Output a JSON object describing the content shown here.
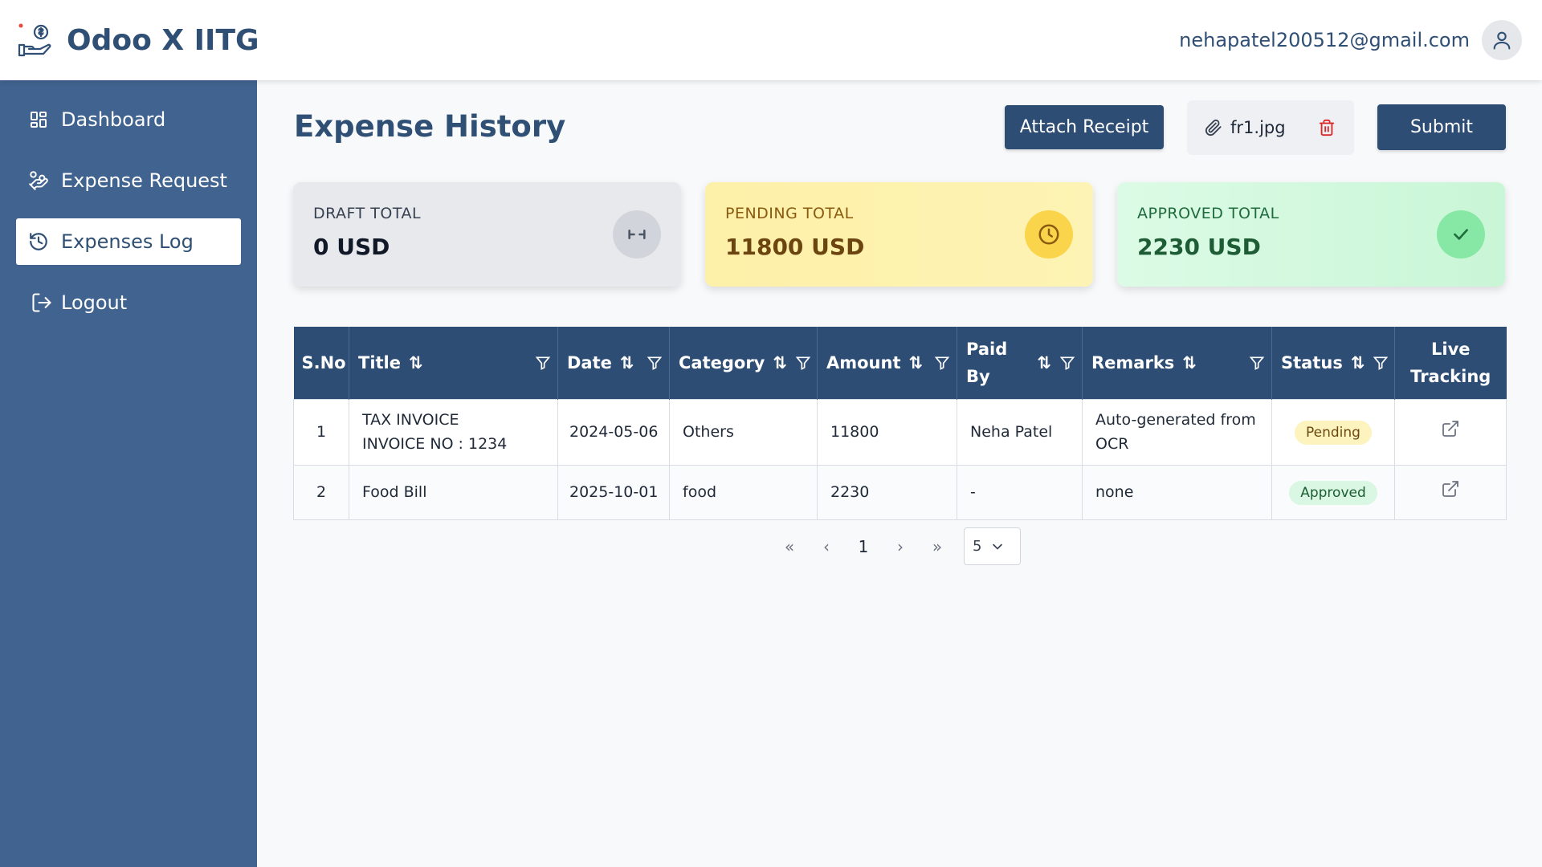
{
  "app": {
    "title": "Odoo X IITG",
    "user_email": "nehapatel200512@gmail.com"
  },
  "sidebar": {
    "items": [
      {
        "label": "Dashboard",
        "icon": "dashboard-grid-icon",
        "active": false
      },
      {
        "label": "Expense Request",
        "icon": "hand-coins-icon",
        "active": false
      },
      {
        "label": "Expenses Log",
        "icon": "history-icon",
        "active": true
      },
      {
        "label": "Logout",
        "icon": "logout-icon",
        "active": false
      }
    ]
  },
  "page": {
    "title": "Expense History",
    "attach_label": "Attach Receipt",
    "file_name": "fr1.jpg",
    "submit_label": "Submit"
  },
  "cards": {
    "draft": {
      "label": "DRAFT TOTAL",
      "value": "0 USD",
      "icon": "hourglass-icon",
      "color": "#e8e9ec"
    },
    "pending": {
      "label": "PENDING TOTAL",
      "value": "11800 USD",
      "icon": "clock-icon",
      "color": "#fdf0a8"
    },
    "approved": {
      "label": "APPROVED TOTAL",
      "value": "2230 USD",
      "icon": "check-icon",
      "color": "#dcfbe6"
    }
  },
  "table": {
    "headers": {
      "sno": "S.No",
      "title": "Title",
      "date": "Date",
      "category": "Category",
      "amount": "Amount",
      "paid_by_1": "Paid",
      "paid_by_2": "By",
      "remarks": "Remarks",
      "status": "Status",
      "live_1": "Live",
      "live_2": "Tracking"
    },
    "rows": [
      {
        "sno": "1",
        "title": "TAX INVOICE INVOICE NO : 1234",
        "date": "2024-05-06",
        "category": "Others",
        "amount": "11800",
        "paid_by": "Neha Patel",
        "remarks": "Auto-generated from OCR",
        "status": "Pending"
      },
      {
        "sno": "2",
        "title": "Food Bill",
        "date": "2025-10-01",
        "category": "food",
        "amount": "2230",
        "paid_by": "-",
        "remarks": "none",
        "status": "Approved"
      }
    ]
  },
  "pagination": {
    "current_page": "1",
    "page_size": "5"
  }
}
